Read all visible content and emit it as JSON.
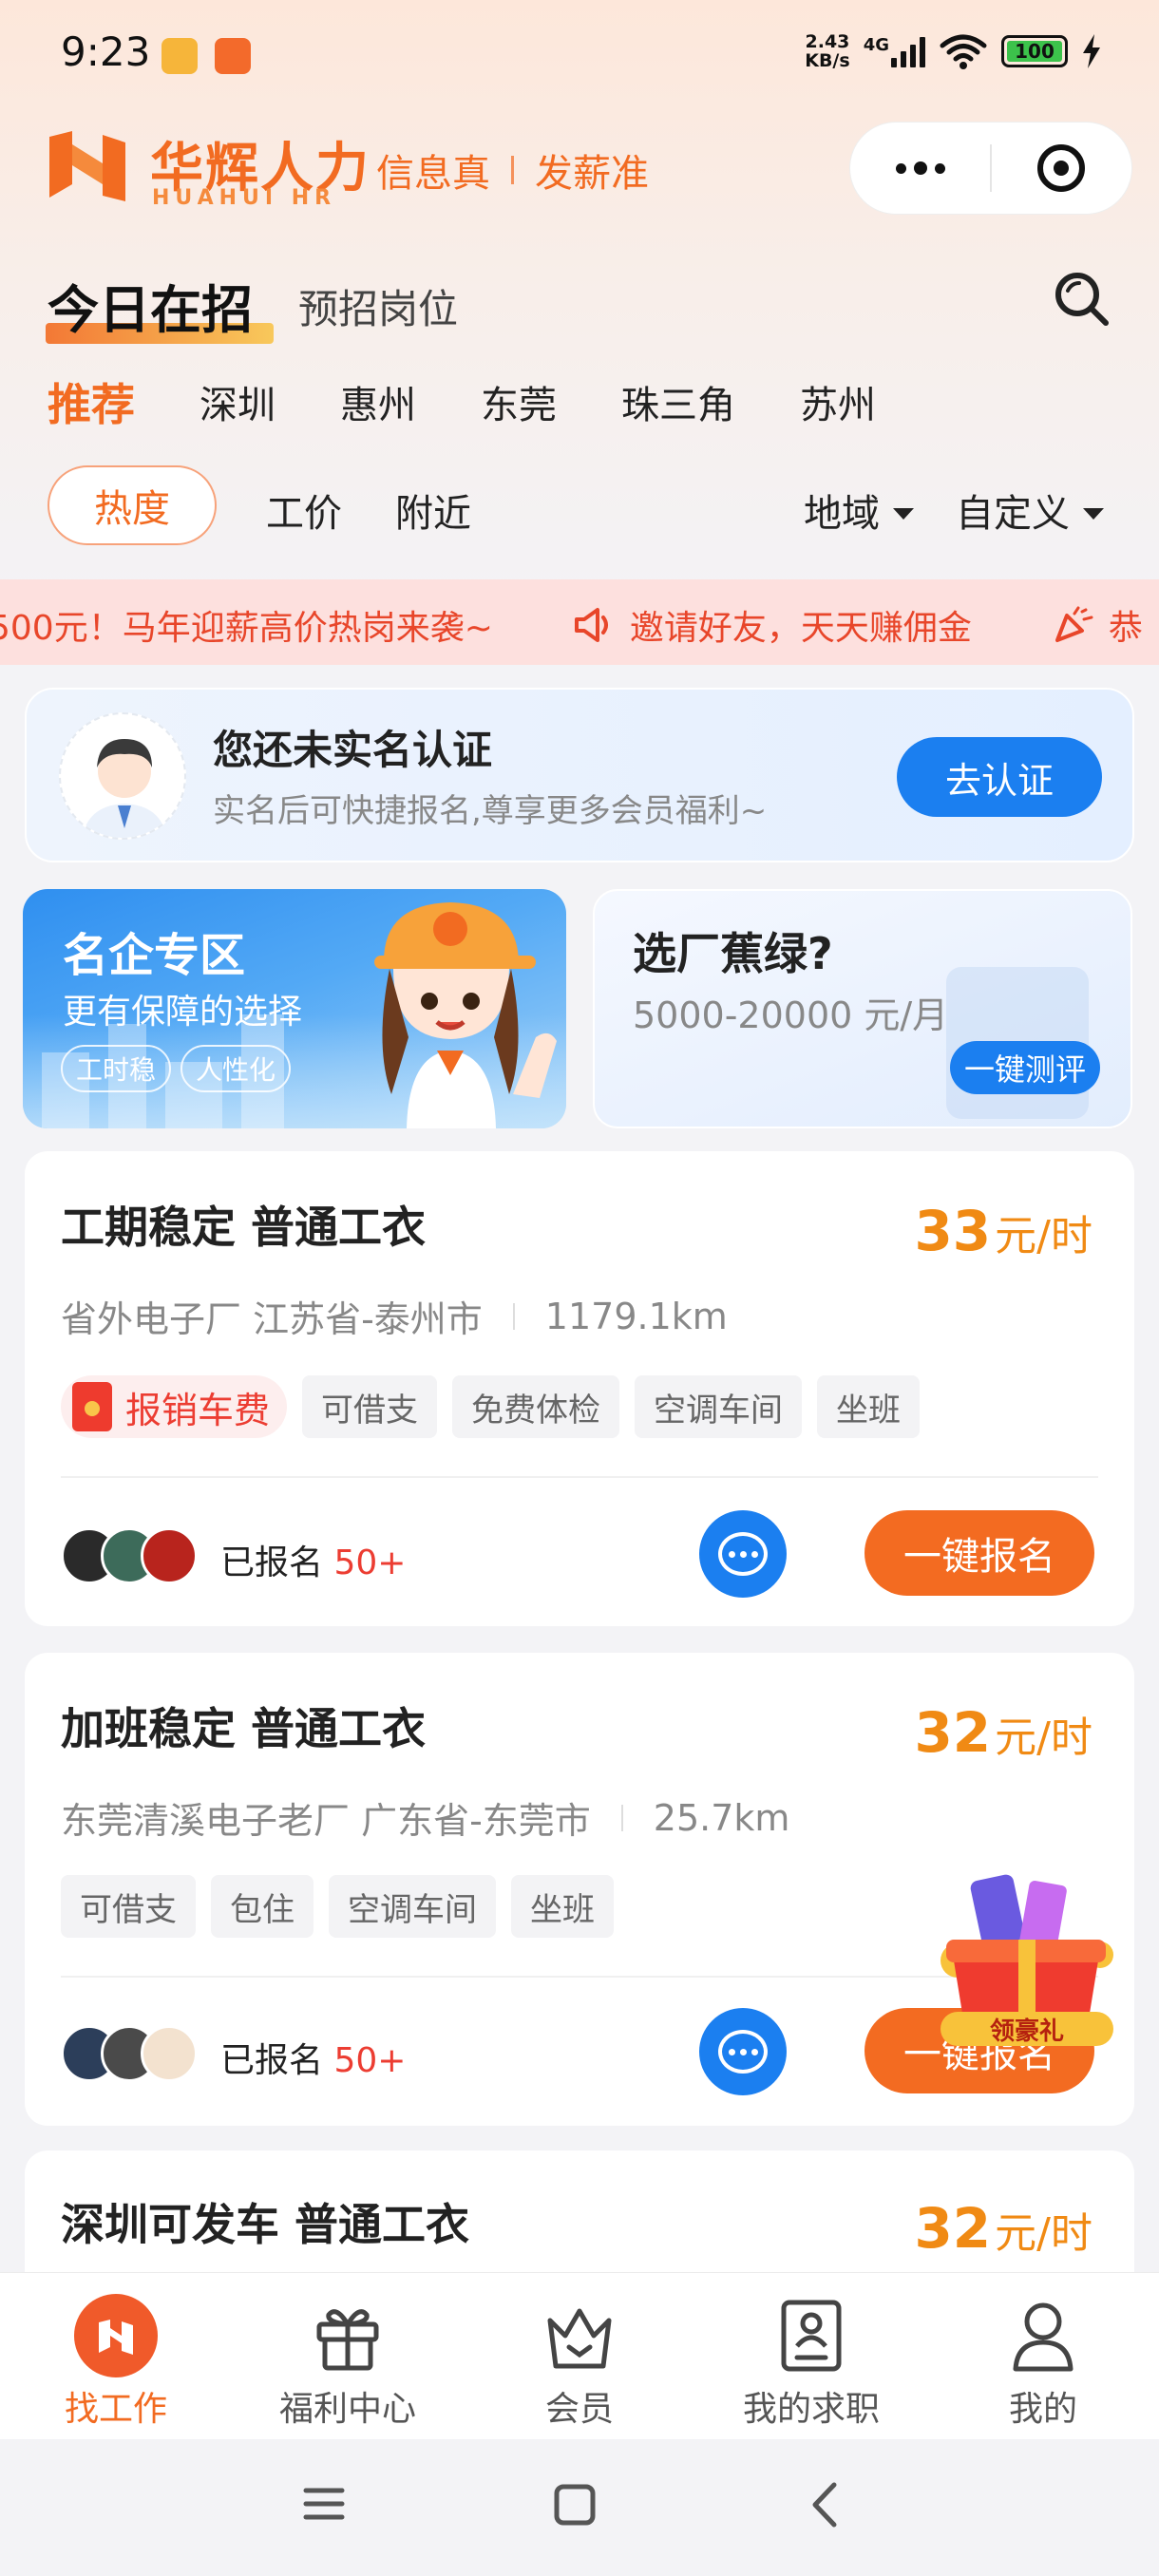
{
  "status_bar": {
    "time": "9:23",
    "net_speed_value": "2.43",
    "net_speed_unit": "KB/s",
    "network": "4G",
    "battery": "100"
  },
  "header": {
    "brand_cn": "华辉人力",
    "brand_en": "HUAHUI HR",
    "slogan_1": "信息真",
    "slogan_2": "发薪准"
  },
  "tabs": {
    "main": "今日在招",
    "sub": "预招岗位"
  },
  "cities": [
    {
      "label": "推荐",
      "active": true
    },
    {
      "label": "深圳",
      "active": false
    },
    {
      "label": "惠州",
      "active": false
    },
    {
      "label": "东莞",
      "active": false
    },
    {
      "label": "珠三角",
      "active": false
    },
    {
      "label": "苏州",
      "active": false
    }
  ],
  "filters": {
    "active": "热度",
    "wage": "工价",
    "nearby": "附近",
    "region": "地域",
    "custom": "自定义"
  },
  "marquee": {
    "text_1": "500元！马年迎薪高价热岗来袭~",
    "text_2": "邀请好友，天天赚佣金",
    "text_3": "恭"
  },
  "verify": {
    "title": "您还未实名认证",
    "desc": "实名后可快捷报名,尊享更多会员福利~",
    "button": "去认证"
  },
  "promo_left": {
    "title": "名企专区",
    "subtitle": "更有保障的选择",
    "tags": [
      "工时稳",
      "人性化"
    ]
  },
  "promo_right": {
    "title": "选厂蕉绿?",
    "subtitle": "5000-20000 元/月",
    "button": "一键测评"
  },
  "jobs": [
    {
      "title": "工期稳定 普通工衣",
      "salary": "33",
      "unit": "元/时",
      "company": "省外电子厂 江苏省-泰州市",
      "distance": "1179.1km",
      "highlight_tag": "报销车费",
      "tags": [
        "可借支",
        "免费体检",
        "空调车间",
        "坐班"
      ],
      "applied_label": "已报名",
      "applied_count": "50+",
      "apply_button": "一键报名"
    },
    {
      "title": "加班稳定 普通工衣",
      "salary": "32",
      "unit": "元/时",
      "company": "东莞清溪电子老厂 广东省-东莞市",
      "distance": "25.7km",
      "tags": [
        "可借支",
        "包住",
        "空调车间",
        "坐班"
      ],
      "applied_label": "已报名",
      "applied_count": "50+",
      "apply_button": "一键报名"
    },
    {
      "title": "深圳可发车 普通工衣",
      "salary": "32",
      "unit": "元/时"
    }
  ],
  "gift_float": {
    "label": "领豪礼"
  },
  "tabbar": [
    {
      "label": "找工作",
      "icon": "find-job-icon",
      "active": true
    },
    {
      "label": "福利中心",
      "icon": "gift-icon",
      "active": false
    },
    {
      "label": "会员",
      "icon": "vip-crown-icon",
      "active": false
    },
    {
      "label": "我的求职",
      "icon": "resume-icon",
      "active": false
    },
    {
      "label": "我的",
      "icon": "user-icon",
      "active": false
    }
  ],
  "colors": {
    "brand_orange": "#f26b21",
    "salary_orange": "#f08a14",
    "primary_blue": "#1b7ff0",
    "highlight_red": "#ec3d32"
  }
}
